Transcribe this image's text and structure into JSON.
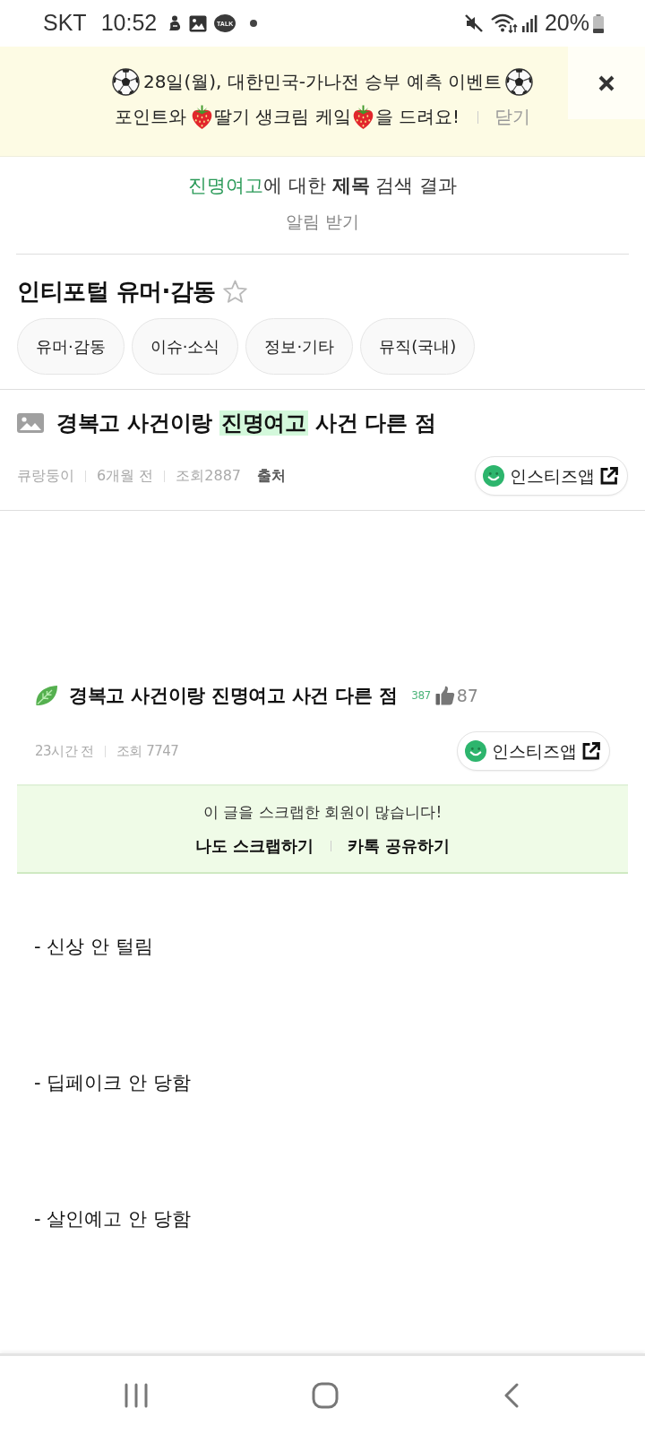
{
  "status_bar": {
    "carrier": "SKT",
    "time": "10:52",
    "chat_badge": "TALK",
    "battery": "20%"
  },
  "banner": {
    "headline": "28일(월), 대한민국-가나전 승부 예측 이벤트",
    "line2": [
      "포인트와",
      "딸기 생크림 케잌",
      "을 드려요!"
    ],
    "dismiss": "닫기"
  },
  "search": {
    "keyword": "진명여고",
    "heading": "에 대한 **제목** 검색 결과",
    "subscribe": "알림 받기"
  },
  "board": {
    "title": "인티포털 유머·감동",
    "favorite": false,
    "categories": [
      "유머·감동",
      "이슈·소식",
      "정보·기타",
      "뮤직(국내)"
    ]
  },
  "post": {
    "title": [
      {
        "text": "경복고 사건이랑",
        "highlight": false
      },
      {
        "text": "진명여고",
        "highlight": true
      },
      {
        "text": "사건 다른 점",
        "highlight": false
      }
    ],
    "author": "큐랑둥이",
    "age": "6개월 전",
    "views": "조회2887",
    "source": "출처",
    "app_button": "인스티즈앱"
  },
  "embedded_post": {
    "title": "경복고 사건이랑 진명여고 사건 다른 점",
    "comment_count": "387",
    "like_count": "87",
    "age": "23시간 전",
    "views": "조회 7747",
    "app_button": "인스티즈앱",
    "scrap_notice": "이 글을 스크랩한 회원이 많습니다!",
    "actions": [
      "나도 스크랩하기",
      "카톡 공유하기"
    ],
    "lines": [
      "- 신상 안 털림",
      "- 딥페이크 안 당함",
      "- 살인예고 안 당함"
    ]
  }
}
